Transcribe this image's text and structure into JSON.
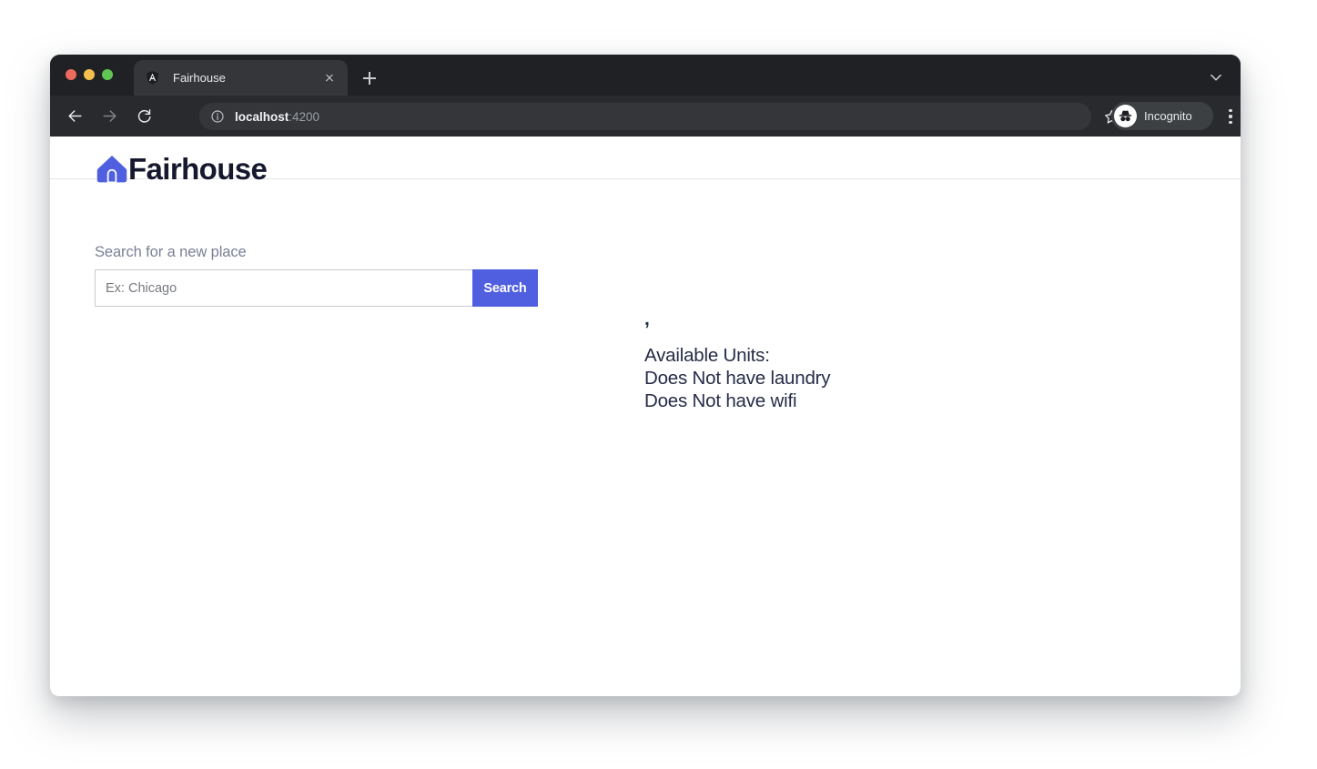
{
  "browser": {
    "tab": {
      "title": "Fairhouse",
      "favicon": "angular-shield-icon",
      "close_label": "×"
    },
    "new_tab_label": "+",
    "omnibox": {
      "host": "localhost",
      "port": ":4200",
      "site_info_icon": "info-circle-icon"
    },
    "profile": {
      "label": "Incognito",
      "icon": "incognito-hat-glasses-icon"
    },
    "controls": {
      "back": "back-arrow",
      "forward": "forward-arrow",
      "reload": "reload-arrow",
      "bookmark": "star-outline",
      "side_panel": "side-panel-square",
      "menu": "three-dot-menu",
      "tab_list": "chevron-down"
    },
    "traffic_lights": [
      "#ed6a5e",
      "#f4bf4f",
      "#61c554"
    ]
  },
  "site": {
    "brand_name": "Fairhouse",
    "brand_logo_icon": "house-icon"
  },
  "search": {
    "label": "Search for a new place",
    "placeholder": "Ex: Chicago",
    "value": "",
    "button_label": "Search"
  },
  "results": {
    "location": ",",
    "lines": [
      "Available Units:",
      "Does Not have laundry",
      "Does Not have wifi"
    ]
  },
  "colors": {
    "accent": "#4f5fe0",
    "brand_text": "#16182f",
    "body_text": "#252c47",
    "muted_label": "#7a7f94",
    "chrome_tabstrip": "#202124",
    "chrome_toolbar": "#292a2d"
  }
}
